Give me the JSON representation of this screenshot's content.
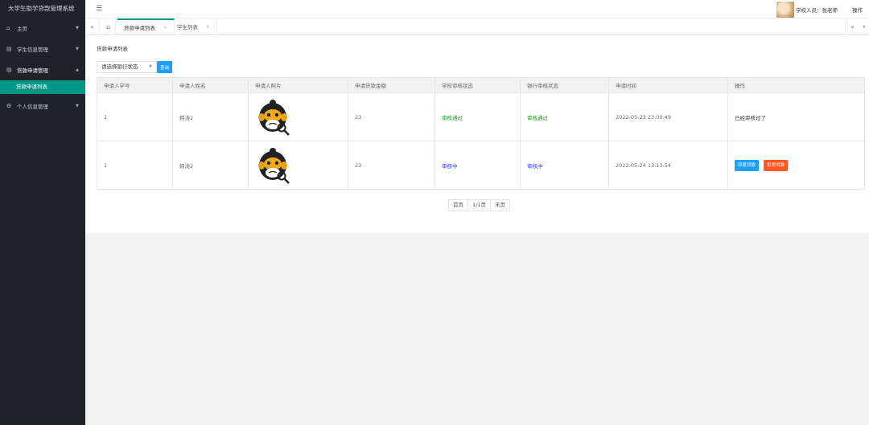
{
  "app": {
    "title": "大学生助学贷款管理系统"
  },
  "sidebar": {
    "items": [
      {
        "label": "主页",
        "icon": "home-icon"
      },
      {
        "label": "学生信息管理",
        "icon": "app-icon"
      },
      {
        "label": "贷款申请管理",
        "icon": "app-icon",
        "sub": [
          {
            "label": "贷款申请列表"
          }
        ]
      },
      {
        "label": "个人信息管理",
        "icon": "gear-icon"
      }
    ]
  },
  "header": {
    "user_label": "学校人员：张老师",
    "op_label": "操作"
  },
  "tabs": [
    {
      "label": "贷款申请列表"
    },
    {
      "label": "学生列表"
    }
  ],
  "main": {
    "title": "贷款申请列表",
    "filter": {
      "selected": "请选择银行状态",
      "search_label": "查询"
    },
    "table": {
      "headers": [
        "申请人学号",
        "申请人姓名",
        "申请人照片",
        "申请贷款金额",
        "学校审核状态",
        "银行审核状态",
        "申请时间",
        "操作"
      ],
      "rows": [
        {
          "id": "1",
          "name": "韩涛2",
          "amount": "23",
          "school_status": "审核通过",
          "bank_status": "审核通过",
          "time": "2022-05-23 23:00:49",
          "op_text": "已经审核过了"
        },
        {
          "id": "1",
          "name": "韩涛2",
          "amount": "23",
          "school_status": "审核中",
          "bank_status": "审核中",
          "time": "2022-05-24 13:13:54",
          "op_pass": "同意贷款",
          "op_reject": "拒绝贷款"
        }
      ]
    },
    "pager": {
      "first": "首页",
      "current": "1/1页",
      "last": "末页"
    }
  }
}
